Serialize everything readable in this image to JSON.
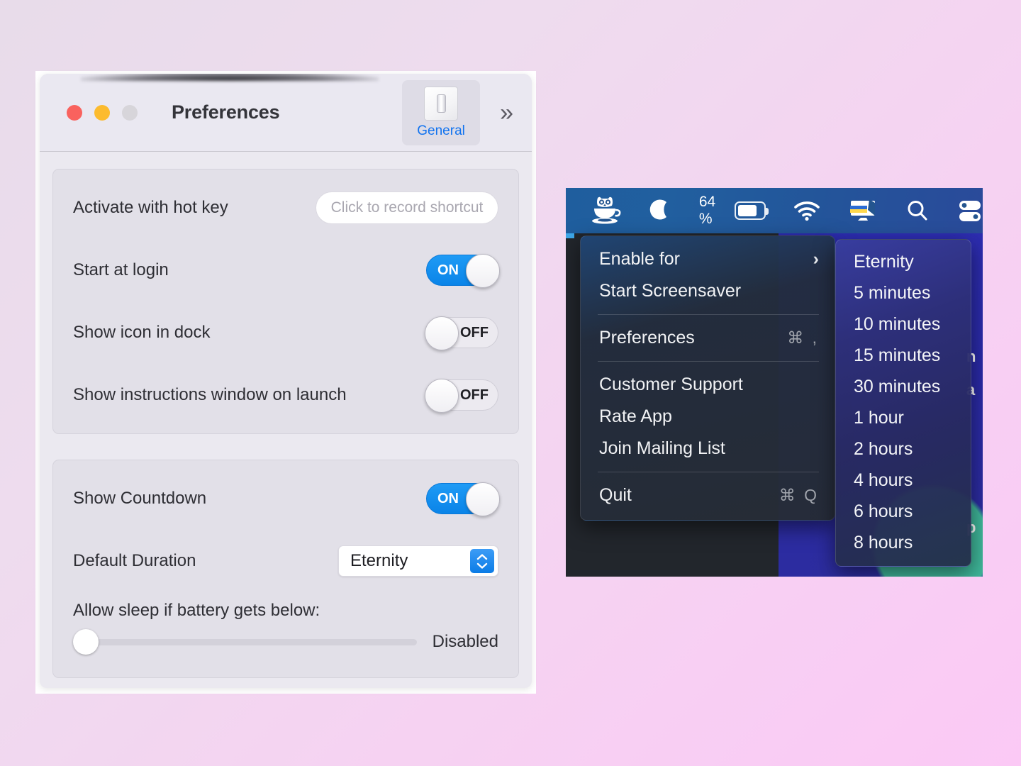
{
  "window": {
    "title": "Preferences",
    "traffic_lights": [
      "close",
      "minimize",
      "zoom"
    ],
    "toolbar": {
      "tab_label": "General",
      "tab_icon": "light-switch-icon",
      "overflow_icon": "double-chevron-right-icon"
    }
  },
  "general": {
    "group1": [
      {
        "label": "Activate with hot key",
        "control": "hotkey-recorder",
        "placeholder": "Click to record shortcut",
        "value": ""
      },
      {
        "label": "Start at login",
        "control": "toggle",
        "state": "ON"
      },
      {
        "label": "Show icon in dock",
        "control": "toggle",
        "state": "OFF"
      },
      {
        "label": "Show instructions window on launch",
        "control": "toggle",
        "state": "OFF"
      }
    ],
    "group2": {
      "show_countdown": {
        "label": "Show Countdown",
        "control": "toggle",
        "state": "ON"
      },
      "default_duration": {
        "label": "Default Duration",
        "control": "popup-button",
        "value": "Eternity"
      },
      "battery_slider": {
        "label": "Allow sleep if battery gets below:",
        "value_text": "Disabled",
        "position_percent": 0
      }
    }
  },
  "menubar": {
    "items": [
      {
        "name": "owl-coffee-cup-icon",
        "label": ""
      },
      {
        "name": "moon-icon",
        "label": ""
      },
      {
        "name": "battery-icon",
        "label": "64 %"
      },
      {
        "name": "wifi-icon",
        "label": ""
      },
      {
        "name": "display-ukraine-flag-icon",
        "label": ""
      },
      {
        "name": "search-icon",
        "label": ""
      },
      {
        "name": "control-center-icon",
        "label": ""
      }
    ],
    "battery_percent": "64 %"
  },
  "app_menu": {
    "items": [
      {
        "label": "Enable for",
        "shortcut": "",
        "submenu": true,
        "arrow": "›"
      },
      {
        "label": "Start Screensaver",
        "shortcut": "",
        "submenu": false
      },
      {
        "separator": true
      },
      {
        "label": "Preferences",
        "shortcut": "⌘ ,",
        "submenu": false
      },
      {
        "separator": true
      },
      {
        "label": "Customer Support",
        "shortcut": "",
        "submenu": false
      },
      {
        "label": "Rate App",
        "shortcut": "",
        "submenu": false
      },
      {
        "label": "Join Mailing List",
        "shortcut": "",
        "submenu": false
      },
      {
        "separator": true
      },
      {
        "label": "Quit",
        "shortcut": "⌘ Q",
        "submenu": false
      }
    ]
  },
  "enable_for_submenu": {
    "items": [
      "Eternity",
      "5 minutes",
      "10 minutes",
      "15 minutes",
      "30 minutes",
      "1 hour",
      "2 hours",
      "4 hours",
      "6 hours",
      "8 hours"
    ]
  },
  "wallpaper_partial_text": [
    "n",
    "a",
    "p"
  ],
  "colors": {
    "accent_blue": "#0a84e8",
    "tab_label_blue": "#1273ef",
    "traffic_red": "#f9625e",
    "traffic_yellow": "#fcbb2e",
    "traffic_grey": "#d7d5da",
    "menubar_blue": "#215f9f",
    "window_bg": "#ebe9f0",
    "group_bg": "#e2e0e8",
    "page_bg_start": "#e8dcea",
    "page_bg_end": "#fbc9f5"
  }
}
